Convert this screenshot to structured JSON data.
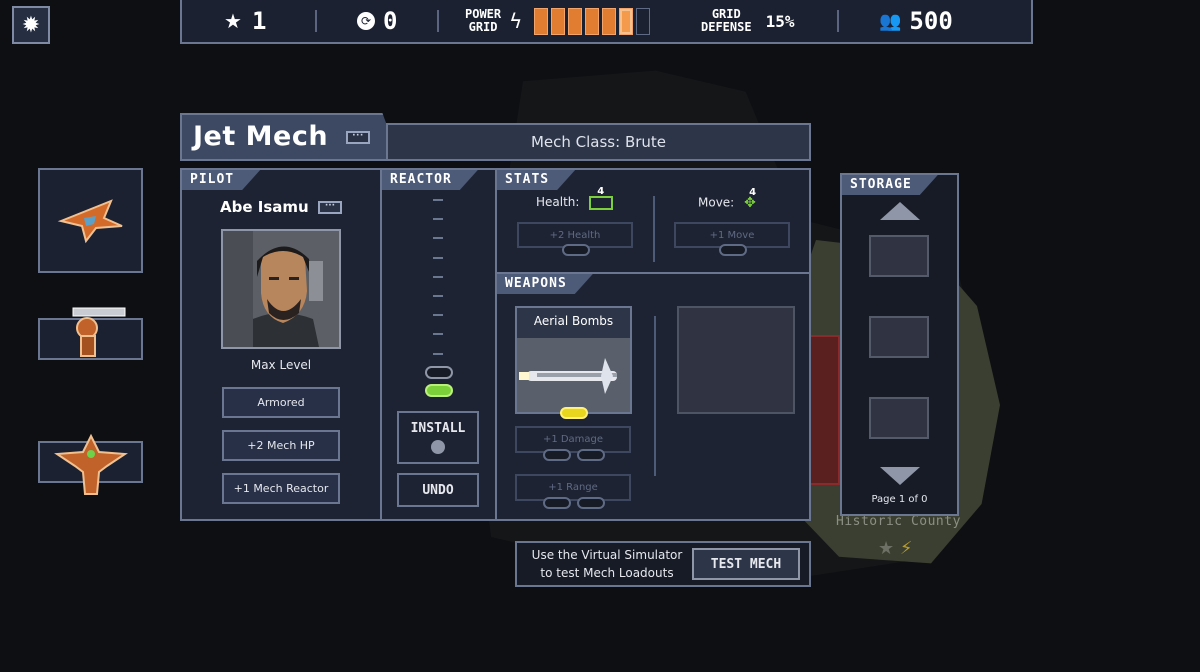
{
  "topbar": {
    "stars": "1",
    "reputation": "0",
    "power_grid_label_1": "POWER",
    "power_grid_label_2": "GRID",
    "power_grid_filled": 6,
    "power_grid_total": 7,
    "grid_defense_label_1": "GRID",
    "grid_defense_label_2": "DEFENSE",
    "grid_defense_value": "15%",
    "people": "500"
  },
  "mech": {
    "name": "Jet Mech",
    "class_label": "Mech Class: Brute"
  },
  "pilot": {
    "tab": "PILOT",
    "name": "Abe Isamu",
    "level": "Max Level",
    "skills": [
      "Armored",
      "+2 Mech HP",
      "+1 Mech Reactor"
    ]
  },
  "reactor": {
    "tab": "REACTOR",
    "install_label": "INSTALL",
    "undo_label": "UNDO"
  },
  "stats": {
    "tab": "STATS",
    "health_label": "Health:",
    "health_value": "4",
    "move_label": "Move:",
    "move_value": "4",
    "health_upgrade": "+2 Health",
    "move_upgrade": "+1 Move"
  },
  "weapons": {
    "tab": "WEAPONS",
    "weapon_name": "Aerial Bombs",
    "upgrade_1": "+1 Damage",
    "upgrade_2": "+1 Range"
  },
  "storage": {
    "tab": "STORAGE",
    "page_label": "Page 1 of 0"
  },
  "simulator": {
    "text_line_1": "Use the Virtual Simulator",
    "text_line_2": "to test Mech Loadouts",
    "button_label": "TEST MECH"
  },
  "map": {
    "region_name": "Historic County"
  },
  "colors": {
    "accent_orange": "#e07d31",
    "panel_bg": "#1d2332",
    "panel_border": "#6b7690",
    "reactor_green": "#7cd13a",
    "weapon_yellow": "#e8d51e"
  }
}
